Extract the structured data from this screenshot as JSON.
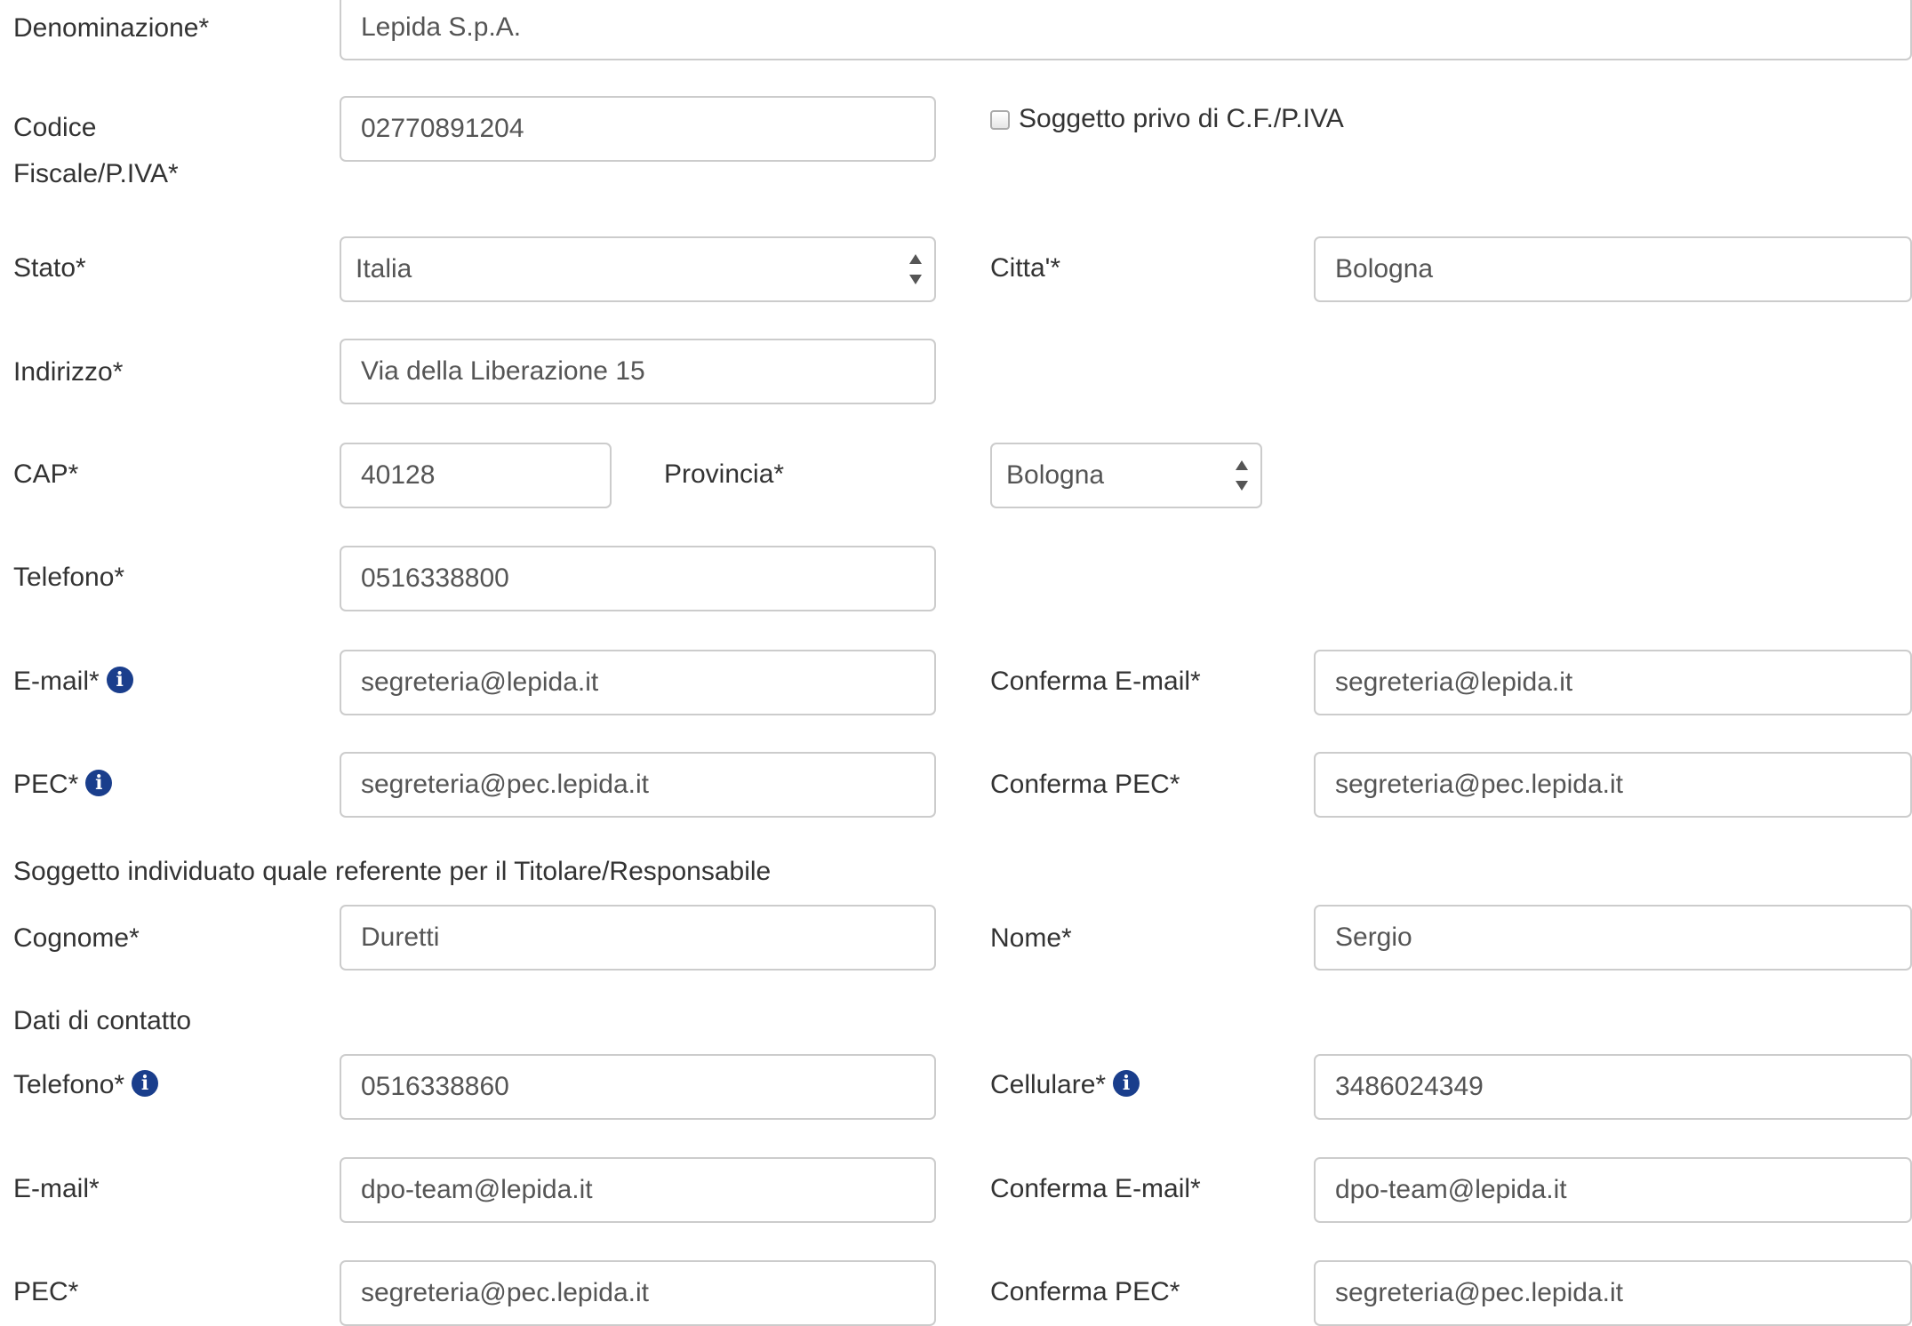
{
  "colors": {
    "info_icon": "#1a3e8c",
    "border": "#cccccc",
    "text": "#333333"
  },
  "form": {
    "denominazione": {
      "label": "Denominazione*",
      "value": "Lepida S.p.A."
    },
    "codice_fiscale": {
      "label_line1": "Codice",
      "label_line2": "Fiscale/P.IVA*",
      "value": "02770891204"
    },
    "soggetto_privo": {
      "label": "Soggetto privo di C.F./P.IVA",
      "checked": false
    },
    "stato": {
      "label": "Stato*",
      "value": "Italia"
    },
    "citta": {
      "label": "Citta'*",
      "value": "Bologna"
    },
    "indirizzo": {
      "label": "Indirizzo*",
      "value": "Via della Liberazione 15"
    },
    "cap": {
      "label": "CAP*",
      "value": "40128"
    },
    "provincia": {
      "label": "Provincia*",
      "value": "Bologna"
    },
    "telefono": {
      "label": "Telefono*",
      "value": "0516338800"
    },
    "email": {
      "label": "E-mail*",
      "value": "segreteria@lepida.it",
      "icon": "info-icon"
    },
    "conferma_email": {
      "label": "Conferma E-mail*",
      "value": "segreteria@lepida.it"
    },
    "pec": {
      "label": "PEC*",
      "value": "segreteria@pec.lepida.it",
      "icon": "info-icon"
    },
    "conferma_pec": {
      "label": "Conferma PEC*",
      "value": "segreteria@pec.lepida.it"
    }
  },
  "referente": {
    "section_title": "Soggetto individuato quale referente per il Titolare/Responsabile",
    "cognome": {
      "label": "Cognome*",
      "value": "Duretti"
    },
    "nome": {
      "label": "Nome*",
      "value": "Sergio"
    }
  },
  "contatto": {
    "section_title": "Dati di contatto",
    "telefono": {
      "label": "Telefono*",
      "value": "0516338860",
      "icon": "info-icon"
    },
    "cellulare": {
      "label": "Cellulare*",
      "value": "3486024349",
      "icon": "info-icon"
    },
    "email": {
      "label": "E-mail*",
      "value": "dpo-team@lepida.it"
    },
    "conferma_email": {
      "label": "Conferma E-mail*",
      "value": "dpo-team@lepida.it"
    },
    "pec": {
      "label": "PEC*",
      "value": "segreteria@pec.lepida.it"
    },
    "conferma_pec": {
      "label": "Conferma PEC*",
      "value": "segreteria@pec.lepida.it"
    }
  }
}
